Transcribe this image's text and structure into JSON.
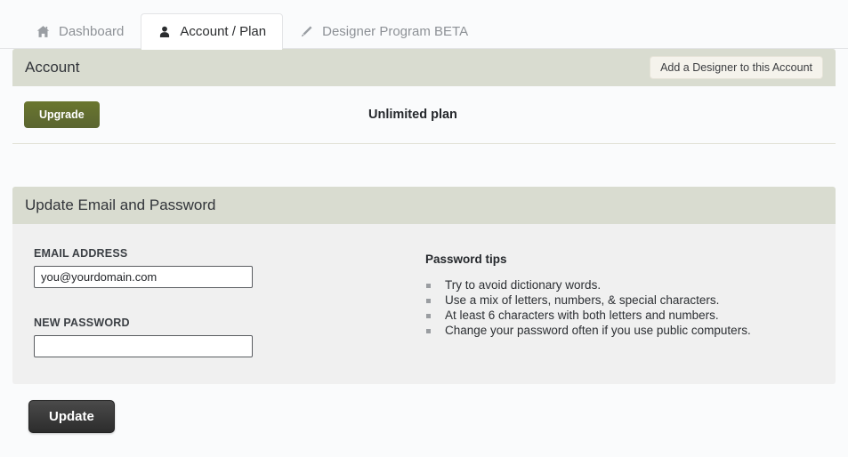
{
  "tabs": [
    {
      "label": "Dashboard",
      "icon": "home-icon",
      "active": false
    },
    {
      "label": "Account / Plan",
      "icon": "user-icon",
      "active": true
    },
    {
      "label": "Designer Program BETA",
      "icon": "pencil-icon",
      "active": false
    }
  ],
  "account_panel": {
    "title": "Account",
    "add_designer_label": "Add a Designer to this Account",
    "upgrade_label": "Upgrade",
    "plan_name": "Unlimited plan"
  },
  "update_panel": {
    "title": "Update Email and Password",
    "email_label": "EMAIL ADDRESS",
    "email_value": "you@yourdomain.com",
    "email_placeholder": "",
    "password_label": "NEW PASSWORD",
    "password_value": "",
    "password_placeholder": "",
    "tips_title": "Password tips",
    "tips": [
      "Try to avoid dictionary words.",
      "Use a mix of letters, numbers, & special characters.",
      "At least 6 characters with both letters and numbers.",
      "Change your password often if you use public computers."
    ]
  },
  "footer": {
    "update_label": "Update"
  },
  "colors": {
    "page_bg": "#fafbfc",
    "panel_header_bg": "#d9dcd0",
    "form_panel_bg": "#f0f0f0",
    "upgrade_green": "#5f6b30",
    "update_dark": "#2c2c2c",
    "tab_inactive_text": "#8d9196",
    "tab_active_text": "#2b2d2f"
  }
}
